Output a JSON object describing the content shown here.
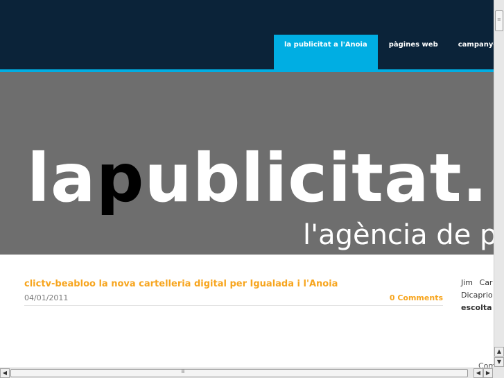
{
  "nav": {
    "items": [
      {
        "label": "la publicitat a l'Anoia",
        "active": true
      },
      {
        "label": "pàgines web",
        "active": false
      },
      {
        "label": "campanyes i p",
        "active": false
      }
    ]
  },
  "banner": {
    "logo_pre": "la",
    "logo_p": "p",
    "logo_post": "ublicitat.n",
    "tagline": "l'agència de pub"
  },
  "post": {
    "title": "clictv-beabloo la nova cartelleria digital per Igualada i l'Anoia",
    "date": "04/01/2011",
    "comments": "0 Comments"
  },
  "sidebar": {
    "line1": "Jim Car",
    "line2": "Dicaprio",
    "line3": "escolta l",
    "bottom": "Com"
  },
  "colors": {
    "topbar": "#0b2339",
    "accent": "#00aee3",
    "banner": "#6e6e6e",
    "link": "#f7a51e"
  }
}
